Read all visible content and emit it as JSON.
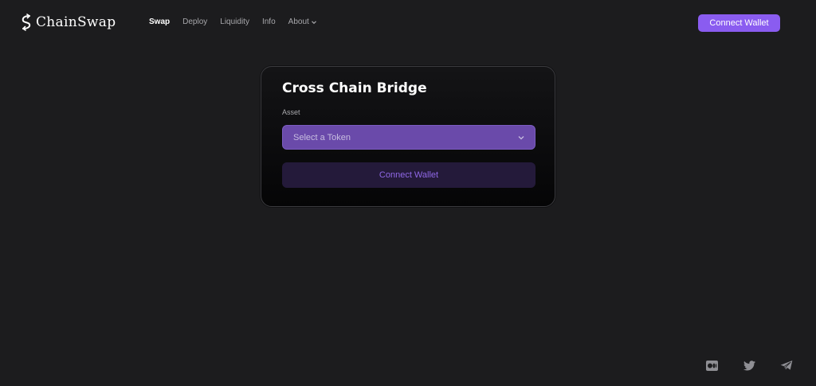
{
  "brand": {
    "name": "ChainSwap"
  },
  "nav": {
    "items": [
      {
        "label": "Swap",
        "active": true
      },
      {
        "label": "Deploy",
        "active": false
      },
      {
        "label": "Liquidity",
        "active": false
      },
      {
        "label": "Info",
        "active": false
      },
      {
        "label": "About",
        "active": false,
        "has_dropdown": true
      }
    ]
  },
  "header": {
    "connect_label": "Connect Wallet"
  },
  "bridge": {
    "title": "Cross Chain Bridge",
    "asset_label": "Asset",
    "token_select_placeholder": "Select a Token",
    "connect_label": "Connect Wallet"
  },
  "footer": {
    "socials": [
      {
        "icon": "medium-icon"
      },
      {
        "icon": "twitter-icon"
      },
      {
        "icon": "telegram-icon"
      }
    ]
  },
  "colors": {
    "background": "#1c1c1e",
    "accent": "#8a5cf0",
    "select_bg": "#6a4aaa",
    "card_button_bg": "#241a3a",
    "card_button_text": "#9068e6"
  }
}
